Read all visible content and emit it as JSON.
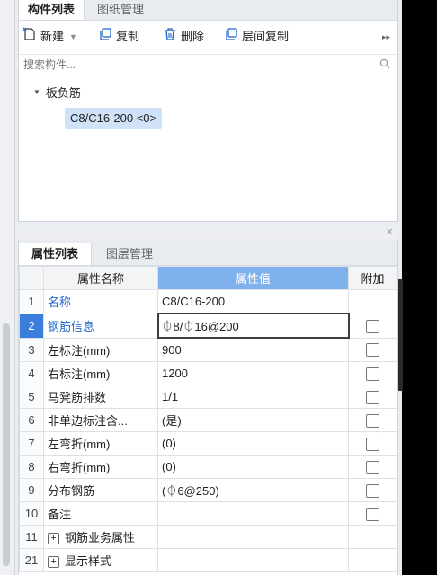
{
  "top_panel": {
    "tabs": [
      {
        "label": "构件列表"
      },
      {
        "label": "图纸管理"
      }
    ],
    "toolbar": {
      "new_label": "新建",
      "copy_label": "复制",
      "delete_label": "删除",
      "floor_copy_label": "层间复制",
      "more_icon": "double-chevron-right-icon"
    },
    "search": {
      "placeholder": "搜索构件..."
    },
    "tree": {
      "group_label": "板负筋",
      "leaf_label": "C8/C16-200 <0>"
    }
  },
  "bottom_panel": {
    "close_icon": "×",
    "tabs": [
      {
        "label": "属性列表"
      },
      {
        "label": "图层管理"
      }
    ],
    "table": {
      "headers": {
        "name": "属性名称",
        "value": "属性值",
        "add": "附加"
      },
      "rows": [
        {
          "num": "1",
          "name": "名称",
          "value": "C8/C16-200"
        },
        {
          "num": "2",
          "name": "钢筋信息",
          "value": "⏀8/⏀16@200"
        },
        {
          "num": "3",
          "name": "左标注(mm)",
          "value": "900"
        },
        {
          "num": "4",
          "name": "右标注(mm)",
          "value": "1200"
        },
        {
          "num": "5",
          "name": "马凳筋排数",
          "value": "1/1"
        },
        {
          "num": "6",
          "name": "非单边标注含...",
          "value": "(是)"
        },
        {
          "num": "7",
          "name": "左弯折(mm)",
          "value": "(0)"
        },
        {
          "num": "8",
          "name": "右弯折(mm)",
          "value": "(0)"
        },
        {
          "num": "9",
          "name": "分布钢筋",
          "value": "(⏀6@250)"
        },
        {
          "num": "10",
          "name": "备注",
          "value": ""
        },
        {
          "num": "11",
          "name": "钢筋业务属性",
          "value": ""
        },
        {
          "num": "21",
          "name": "显示样式",
          "value": ""
        }
      ]
    }
  },
  "colors": {
    "accent_blue": "#3b7ddd",
    "header_value_blue": "#7fb1ec",
    "name_blue": "#1f66c8",
    "selected_leaf_bg": "#cfe2f8"
  }
}
